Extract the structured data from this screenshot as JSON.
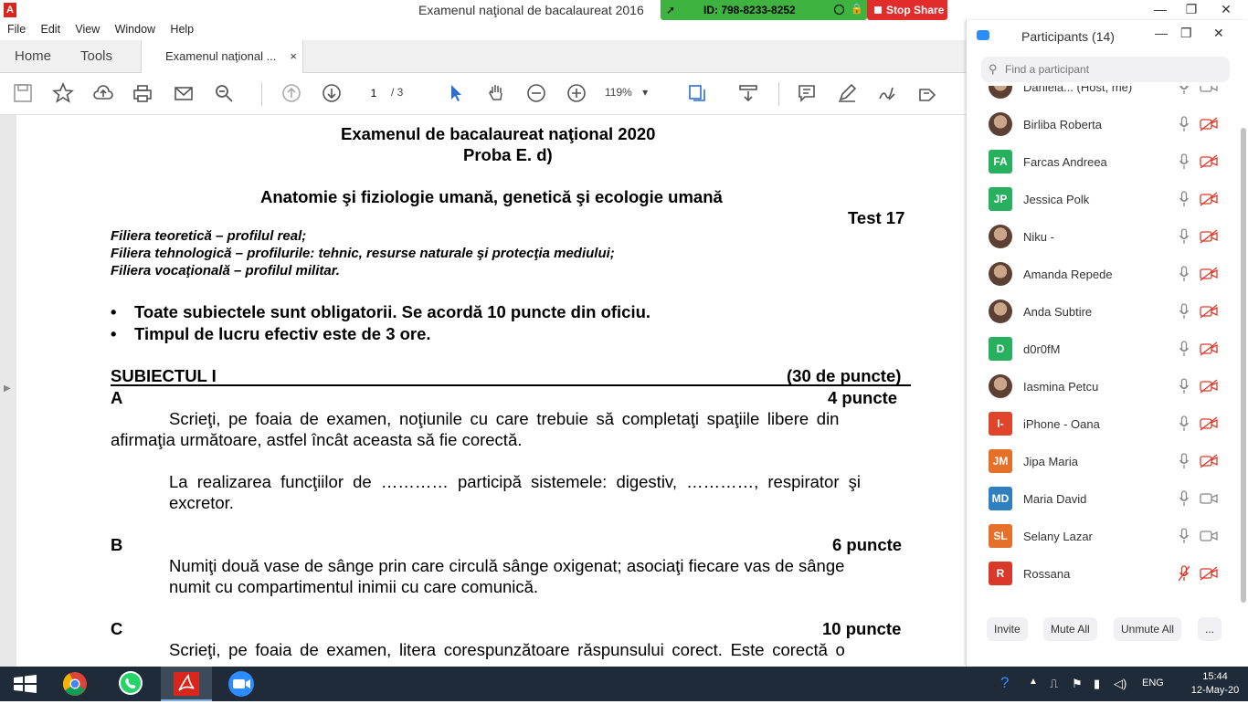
{
  "window": {
    "title": "Examenul naţional de bacalaureat 2016",
    "app_icon": "pdf-icon",
    "minimize": "—",
    "restore": "❐",
    "close": "✕"
  },
  "zoom_share": {
    "meeting_id": "ID: 798-8233-8252",
    "stop_share_label": "Stop Share",
    "bar_color": "#3fb33f",
    "stop_color": "#e22c2c"
  },
  "menu": [
    "File",
    "Edit",
    "View",
    "Window",
    "Help"
  ],
  "tabs": {
    "home": "Home",
    "tools": "Tools",
    "document": "Examenul naţional ...",
    "close": "×"
  },
  "toolbar": {
    "current_page": "1",
    "total_pages": "/ 3",
    "zoom": "119%",
    "icons": [
      "save-icon",
      "star-icon",
      "upload-icon",
      "print-icon",
      "mail-icon",
      "search-icon",
      "page-up-icon",
      "page-down-icon",
      "select-cursor-icon",
      "hand-icon",
      "zoom-out-icon",
      "zoom-in-icon",
      "fit-page-icon",
      "scroll-mode-icon",
      "comment-icon",
      "pen-icon",
      "sign-icon",
      "more-tools-icon"
    ]
  },
  "document": {
    "heading1": "Examenul de bacalaureat naţional 2020",
    "heading2": "Proba E. d)",
    "subject": "Anatomie şi fiziologie umană, genetică şi ecologie umană",
    "test": "Test 17",
    "filiera1": "Filiera teoretică – profilul real;",
    "filiera2": "Filiera tehnologică – profilurile: tehnic, resurse naturale şi protecţia mediului;",
    "filiera3": "Filiera vocaţională – profilul militar.",
    "bullet1": "Toate subiectele sunt obligatorii. Se acordă 10 puncte din oficiu.",
    "bullet2": "Timpul de lucru efectiv este de 3 ore.",
    "subiect_label": "SUBIECTUL I",
    "subiect_points": "(30 de puncte)",
    "a_label": "A",
    "a_points": "4 puncte",
    "a_line1": "Scrieţi, pe foaia de examen, noţiunile cu care trebuie să completaţi spaţiile libere din",
    "a_line2": "afirmaţia următoare, astfel încât aceasta să fie corectă.",
    "a_stmt1": "La realizarea funcţiilor de ………… participă sistemele: digestiv, …………, respirator şi",
    "a_stmt2": "excretor.",
    "b_label": "B",
    "b_points": "6 puncte",
    "b_line1": "Numiţi două vase de sânge prin care circulă sânge oxigenat; asociaţi fiecare vas de sânge",
    "b_line2": "numit cu compartimentul inimii cu care comunică.",
    "c_label": "C",
    "c_points": "10 puncte",
    "c_line1": "Scrieţi, pe foaia de examen, litera corespunzătoare răspunsului corect. Este corectă o"
  },
  "participants": {
    "title": "Participants (14)",
    "search_placeholder": "Find a participant",
    "list": [
      {
        "name": "Daniela... (Host, me)",
        "initials": "",
        "color": "#6b5a4a",
        "photo": true,
        "mic": "on",
        "cam": "on"
      },
      {
        "name": "Birliba Roberta",
        "initials": "",
        "color": "#a0785a",
        "photo": true,
        "mic": "on",
        "cam": "off"
      },
      {
        "name": "Farcas Andreea",
        "initials": "FA",
        "color": "#27b15e",
        "photo": false,
        "mic": "on",
        "cam": "off"
      },
      {
        "name": "Jessica Polk",
        "initials": "JP",
        "color": "#27b15e",
        "photo": false,
        "mic": "on",
        "cam": "off"
      },
      {
        "name": "Niku -",
        "initials": "",
        "color": "#3a3a3a",
        "photo": true,
        "mic": "on",
        "cam": "off"
      },
      {
        "name": "Amanda Repede",
        "initials": "",
        "color": "#8a6a55",
        "photo": true,
        "mic": "on",
        "cam": "off"
      },
      {
        "name": "Anda Subtire",
        "initials": "",
        "color": "#b08a70",
        "photo": true,
        "mic": "on",
        "cam": "off"
      },
      {
        "name": "d0r0fM",
        "initials": "D",
        "color": "#27b15e",
        "photo": false,
        "mic": "on",
        "cam": "off"
      },
      {
        "name": "Iasmina Petcu",
        "initials": "",
        "color": "#9c8878",
        "photo": true,
        "mic": "on",
        "cam": "off"
      },
      {
        "name": "iPhone - Oana",
        "initials": "I-",
        "color": "#e0452c",
        "photo": false,
        "mic": "on",
        "cam": "off"
      },
      {
        "name": "Jipa Maria",
        "initials": "JM",
        "color": "#e5702a",
        "photo": false,
        "mic": "on",
        "cam": "off"
      },
      {
        "name": "Maria David",
        "initials": "MD",
        "color": "#2f7fc1",
        "photo": false,
        "mic": "on",
        "cam": "on"
      },
      {
        "name": "Selany Lazar",
        "initials": "SL",
        "color": "#e5702a",
        "photo": false,
        "mic": "on",
        "cam": "on"
      },
      {
        "name": "Rossana",
        "initials": "R",
        "color": "#d9382b",
        "photo": false,
        "mic": "off",
        "cam": "off"
      }
    ],
    "invite": "Invite",
    "mute_all": "Mute All",
    "unmute_all": "Unmute All",
    "more": "..."
  },
  "taskbar": {
    "apps": [
      "windows-start-icon",
      "chrome-icon",
      "whatsapp-icon",
      "acrobat-icon",
      "zoom-icon"
    ],
    "lang": "ENG",
    "time": "15:44",
    "date": "12-May-20"
  }
}
